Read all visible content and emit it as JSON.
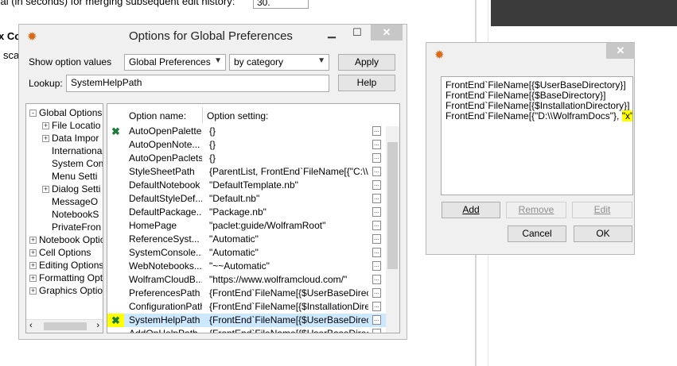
{
  "background": {
    "top_text": "val (in seconds) for merging subsequent edit history:",
    "top_value": "30.",
    "side_text1": "x Co",
    "side_text2": "sca"
  },
  "main_dialog": {
    "title": "Options for Global Preferences",
    "show_option_values_label": "Show option values",
    "scope_select": "Global Preferences",
    "order_select": "by category",
    "apply_label": "Apply",
    "lookup_label": "Lookup:",
    "lookup_value": "SystemHelpPath",
    "help_label": "Help",
    "tree": [
      {
        "label": "Global Options",
        "expand": "-"
      },
      {
        "label": "File Locatio",
        "expand": "+"
      },
      {
        "label": "Data Impor",
        "expand": "+"
      },
      {
        "label": "Internationa",
        "expand": ""
      },
      {
        "label": "System Con",
        "expand": ""
      },
      {
        "label": "Menu Setti",
        "expand": ""
      },
      {
        "label": "Dialog Setti",
        "expand": "+"
      },
      {
        "label": "MessageO",
        "expand": ""
      },
      {
        "label": "NotebookS",
        "expand": ""
      },
      {
        "label": "PrivateFron",
        "expand": ""
      },
      {
        "label": "Notebook Optio",
        "expand": "+"
      },
      {
        "label": "Cell Options",
        "expand": "+"
      },
      {
        "label": "Editing Options",
        "expand": "+"
      },
      {
        "label": "Formatting Opti",
        "expand": "+"
      },
      {
        "label": "Graphics Optio",
        "expand": "+"
      }
    ],
    "col_option_name": "Option name:",
    "col_option_setting": "Option setting:",
    "options": [
      {
        "name": "AutoOpenPalettes",
        "value": "{}",
        "mark": "x"
      },
      {
        "name": "AutoOpenNote...",
        "value": "{}",
        "mark": ""
      },
      {
        "name": "AutoOpenPaclets",
        "value": "{}",
        "mark": ""
      },
      {
        "name": "StyleSheetPath",
        "value": "{ParentList, FrontEnd`FileName[{\"C:\\\\...",
        "mark": ""
      },
      {
        "name": "DefaultNotebook",
        "value": "\"DefaultTemplate.nb\"",
        "mark": ""
      },
      {
        "name": "DefaultStyleDef...",
        "value": "\"Default.nb\"",
        "mark": ""
      },
      {
        "name": "DefaultPackage...",
        "value": "\"Package.nb\"",
        "mark": ""
      },
      {
        "name": "HomePage",
        "value": "\"paclet:guide/WolframRoot\"",
        "mark": ""
      },
      {
        "name": "ReferenceSyst...",
        "value": "\"Automatic\"",
        "mark": ""
      },
      {
        "name": "SystemConsole...",
        "value": "\"Automatic\"",
        "mark": ""
      },
      {
        "name": "WebNotebooks...",
        "value": "\"~~Automatic\"",
        "mark": ""
      },
      {
        "name": "WolframCloudB...",
        "value": "\"https://www.wolframcloud.com/\"",
        "mark": ""
      },
      {
        "name": "PreferencesPath",
        "value": "{FrontEnd`FileName[{$UserBaseDirect...",
        "mark": ""
      },
      {
        "name": "ConfigurationPath",
        "value": "{FrontEnd`FileName[{$InstallationDire...",
        "mark": ""
      },
      {
        "name": "SystemHelpPath",
        "value": "{FrontEnd`FileName[{$UserBaseDirect...",
        "mark": "x"
      },
      {
        "name": "AddOnHelpPath",
        "value": "{FrontEnd`FileName[{$UserBaseDirect...",
        "mark": ""
      }
    ]
  },
  "edit_dialog": {
    "lines": [
      "FrontEnd`FileName[{$UserBaseDirectory}]",
      "FrontEnd`FileName[{$BaseDirectory}]",
      "FrontEnd`FileName[{$InstallationDirectory}]"
    ],
    "last_line_prefix": "FrontEnd`FileName[{\"D:\\\\WolframDocs\"}, ",
    "last_line_highlight": "\"x\"]",
    "add_label": "Add",
    "remove_label": "Remove",
    "edit_label": "Edit",
    "cancel_label": "Cancel",
    "ok_label": "OK"
  },
  "colors": {
    "highlight": "#ffff00",
    "selection": "#cce8ff",
    "mark_green": "#1a7a3a",
    "icon_orange": "#d86a1a"
  }
}
